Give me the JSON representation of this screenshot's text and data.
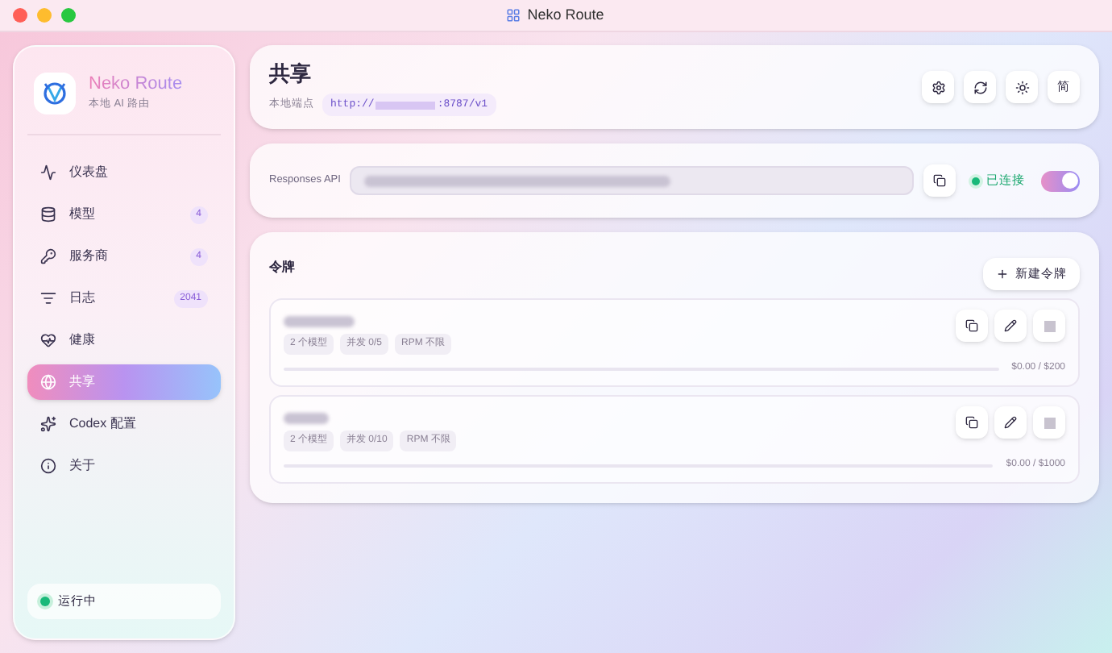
{
  "window": {
    "title": "Neko Route"
  },
  "brand": {
    "name": "Neko Route",
    "subtitle": "本地 AI 路由"
  },
  "sidebar": {
    "items": [
      {
        "kind": "dashboard",
        "label": "仪表盘",
        "selected": false
      },
      {
        "kind": "models",
        "label": "模型",
        "badge": "4",
        "selected": false
      },
      {
        "kind": "providers",
        "label": "服务商",
        "badge": "4",
        "selected": false
      },
      {
        "kind": "logs",
        "label": "日志",
        "badge": "2041",
        "selected": false
      },
      {
        "kind": "health",
        "label": "健康",
        "selected": false
      },
      {
        "kind": "share",
        "label": "共享",
        "selected": true
      },
      {
        "kind": "codex",
        "label": "Codex 配置",
        "selected": false
      },
      {
        "kind": "about",
        "label": "关于",
        "selected": false
      }
    ],
    "status": {
      "label": "运行中",
      "running": true
    }
  },
  "header": {
    "title": "共享",
    "endpoint_label": "本地端点",
    "url_prefix": "http://",
    "url_suffix": ":8787/v1",
    "language_button": "简"
  },
  "api": {
    "label": "Responses API",
    "status": "已连接",
    "connected": true,
    "enabled": true
  },
  "tokens": {
    "title": "令牌",
    "new_button": "新建令牌",
    "items": [
      {
        "tags": [
          "2 个模型",
          "并发 0/5",
          "RPM 不限"
        ],
        "level": 0,
        "usage": "$0.00 / $200"
      },
      {
        "tags": [
          "2 个模型",
          "并发 0/10",
          "RPM 不限"
        ],
        "level": 0,
        "usage": "$0.00 / $1000"
      }
    ]
  }
}
